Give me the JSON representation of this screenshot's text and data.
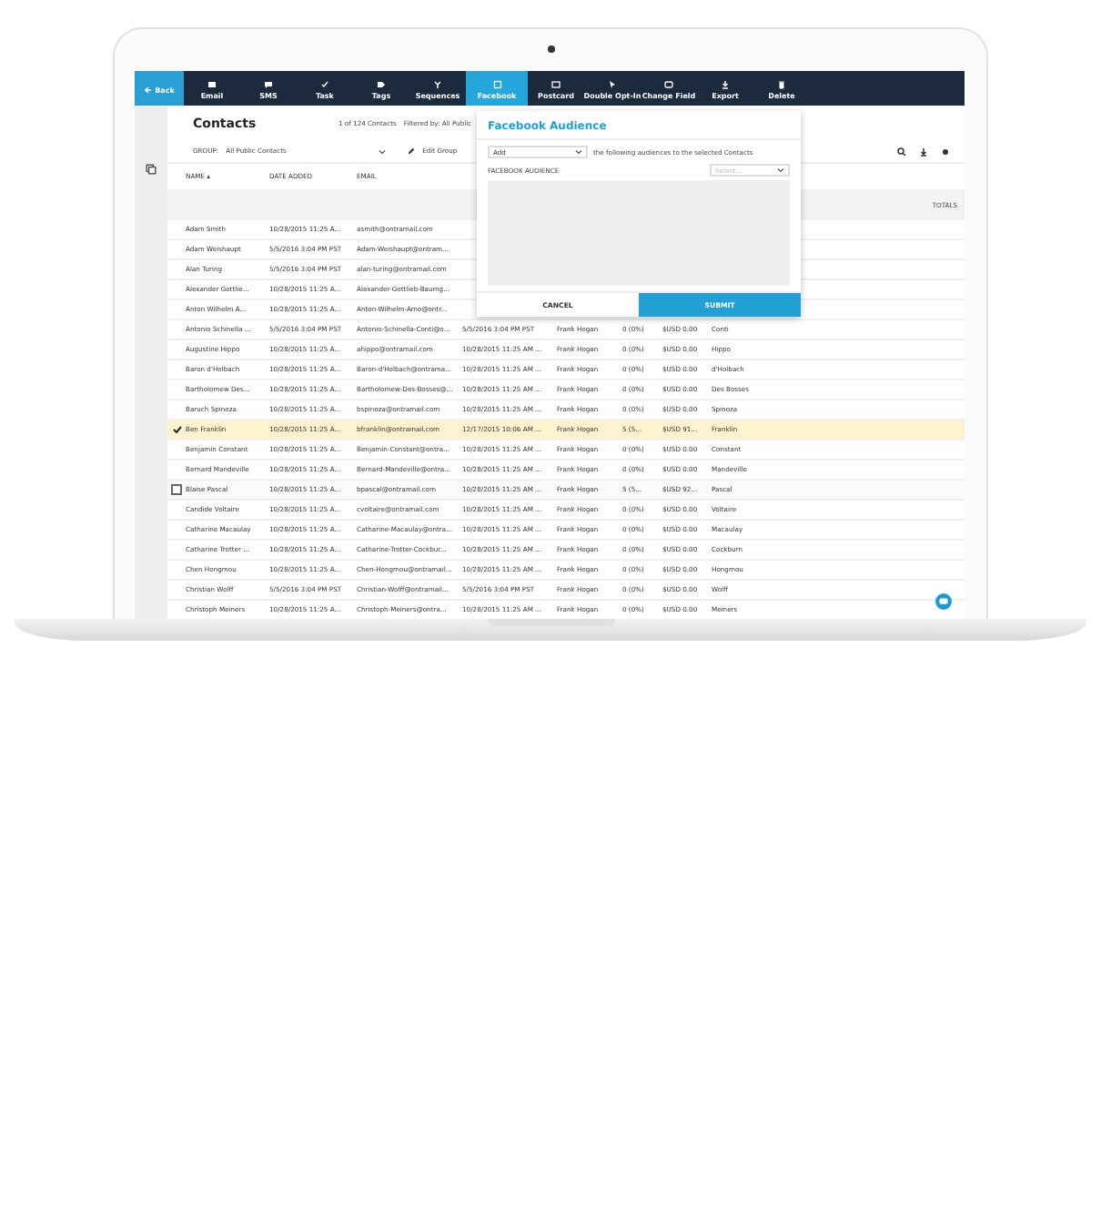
{
  "back": "Back",
  "toolbar": [
    {
      "label": "Email",
      "kind": "email",
      "selected": false
    },
    {
      "label": "SMS",
      "kind": "sms",
      "selected": false
    },
    {
      "label": "Task",
      "kind": "task",
      "selected": false
    },
    {
      "label": "Tags",
      "kind": "tags",
      "selected": false
    },
    {
      "label": "Sequences",
      "kind": "sequences",
      "selected": false
    },
    {
      "label": "Facebook",
      "kind": "facebook",
      "selected": true
    },
    {
      "label": "Postcard",
      "kind": "postcard",
      "selected": false
    },
    {
      "label": "Double Opt-In",
      "kind": "optin",
      "selected": false
    },
    {
      "label": "Change Field",
      "kind": "field",
      "selected": false
    },
    {
      "label": "Export",
      "kind": "export",
      "selected": false
    },
    {
      "label": "Delete",
      "kind": "delete",
      "selected": false
    }
  ],
  "page": {
    "title": "Contacts",
    "count": "1 of 124 Contacts",
    "filter": "Filtered by: All Public",
    "group_label": "GROUP:",
    "group_value": "All Public Contacts",
    "edit_group": "Edit Group"
  },
  "table": {
    "columns": [
      "NAME ▴",
      "DATE ADDED",
      "EMAIL"
    ],
    "totals": "TOTALS",
    "rows": [
      {
        "selected": false,
        "hovered": false,
        "cells": [
          "Adam Smith",
          "10/28/2015 11:25 A...",
          "asmith@ontramail.com"
        ]
      },
      {
        "selected": false,
        "hovered": false,
        "cells": [
          "Adam Weishaupt",
          "5/5/2016 3:04 PM PST",
          "Adam-Weishaupt@ontram..."
        ]
      },
      {
        "selected": false,
        "hovered": false,
        "cells": [
          "Alan Turing",
          "5/5/2016 3:04 PM PST",
          "alan-turing@ontramail.com"
        ]
      },
      {
        "selected": false,
        "hovered": false,
        "cells": [
          "Alexander Gottlie...",
          "10/28/2015 11:25 A...",
          "Alexander-Gottlieb-Baumg..."
        ]
      },
      {
        "selected": false,
        "hovered": false,
        "cells": [
          "Anton Wilhelm A...",
          "10/28/2015 11:25 A...",
          "Anton-Wilhelm-Amo@ontr..."
        ]
      },
      {
        "selected": false,
        "hovered": false,
        "cells": [
          "Antonio Schinella ...",
          "5/5/2016 3:04 PM PST",
          "Antonio-Schinella-Conti@o...",
          "5/5/2016 3:04 PM PST",
          "Frank Hogan",
          "0 (0%)",
          "$USD 0.00",
          "Conti"
        ]
      },
      {
        "selected": false,
        "hovered": false,
        "cells": [
          "Augustine Hippo",
          "10/28/2015 11:25 A...",
          "ahippo@ontramail.com",
          "10/28/2015 11:25 AM ...",
          "Frank Hogan",
          "0 (0%)",
          "$USD 0.00",
          "Hippo"
        ]
      },
      {
        "selected": false,
        "hovered": false,
        "cells": [
          "Baron d'Holbach",
          "10/28/2015 11:25 A...",
          "Baron-d'Holbach@ontrama...",
          "10/28/2015 11:25 AM ...",
          "Frank Hogan",
          "0 (0%)",
          "$USD 0.00",
          "d'Holbach"
        ]
      },
      {
        "selected": false,
        "hovered": false,
        "cells": [
          "Bartholomew Des...",
          "10/28/2015 11:25 A...",
          "Bartholomew-Des-Bosses@...",
          "10/28/2015 11:25 AM ...",
          "Frank Hogan",
          "0 (0%)",
          "$USD 0.00",
          "Des Bosses"
        ]
      },
      {
        "selected": false,
        "hovered": false,
        "cells": [
          "Baruch Spinoza",
          "10/28/2015 11:25 A...",
          "bspinoza@ontramail.com",
          "10/28/2015 11:25 AM ...",
          "Frank Hogan",
          "0 (0%)",
          "$USD 0.00",
          "Spinoza"
        ]
      },
      {
        "selected": true,
        "hovered": false,
        "cells": [
          "Ben Franklin",
          "10/28/2015 11:25 A...",
          "bfranklin@ontramail.com",
          "12/17/2015 10:06 AM ...",
          "Frank Hogan",
          "5 (5...",
          "$USD 91...",
          "Franklin"
        ]
      },
      {
        "selected": false,
        "hovered": false,
        "cells": [
          "Benjamin Constant",
          "10/28/2015 11:25 A...",
          "Benjamin-Constant@ontra...",
          "10/28/2015 11:25 AM ...",
          "Frank Hogan",
          "0 (0%)",
          "$USD 0.00",
          "Constant"
        ]
      },
      {
        "selected": false,
        "hovered": false,
        "cells": [
          "Bernard Mandeville",
          "10/28/2015 11:25 A...",
          "Bernard-Mandeville@ontra...",
          "10/28/2015 11:25 AM ...",
          "Frank Hogan",
          "0 (0%)",
          "$USD 0.00",
          "Mandeville"
        ]
      },
      {
        "selected": false,
        "hovered": true,
        "cells": [
          "Blaise Pascal",
          "10/28/2015 11:25 A...",
          "bpascal@ontramail.com",
          "10/28/2015 11:25 AM ...",
          "Frank Hogan",
          "5 (5...",
          "$USD 92...",
          "Pascal"
        ]
      },
      {
        "selected": false,
        "hovered": false,
        "cells": [
          "Candide Voltaire",
          "10/28/2015 11:25 A...",
          "cvoltaire@ontramail.com",
          "10/28/2015 11:25 AM ...",
          "Frank Hogan",
          "0 (0%)",
          "$USD 0.00",
          "Voltaire"
        ]
      },
      {
        "selected": false,
        "hovered": false,
        "cells": [
          "Catharine Macaulay",
          "10/28/2015 11:25 A...",
          "Catharine-Macaulay@ontra...",
          "10/28/2015 11:25 AM ...",
          "Frank Hogan",
          "0 (0%)",
          "$USD 0.00",
          "Macaulay"
        ]
      },
      {
        "selected": false,
        "hovered": false,
        "cells": [
          "Catharine Trotter ...",
          "10/28/2015 11:25 A...",
          "Catharine-Trotter-Cockbur...",
          "10/28/2015 11:25 AM ...",
          "Frank Hogan",
          "0 (0%)",
          "$USD 0.00",
          "Cockburn"
        ]
      },
      {
        "selected": false,
        "hovered": false,
        "cells": [
          "Chen Hongmou",
          "10/28/2015 11:25 A...",
          "Chen-Hongmou@ontramail...",
          "10/28/2015 11:25 AM ...",
          "Frank Hogan",
          "0 (0%)",
          "$USD 0.00",
          "Hongmou"
        ]
      },
      {
        "selected": false,
        "hovered": false,
        "cells": [
          "Christian Wolff",
          "5/5/2016 3:04 PM PST",
          "Christian-Wolff@ontramail...",
          "5/5/2016 3:04 PM PST",
          "Frank Hogan",
          "0 (0%)",
          "$USD 0.00",
          "Wolff"
        ]
      },
      {
        "selected": false,
        "hovered": false,
        "cells": [
          "Christoph Meiners",
          "10/28/2015 11:25 A...",
          "Christoph-Meiners@ontra...",
          "10/28/2015 11:25 AM ...",
          "Frank Hogan",
          "0 (0%)",
          "$USD 0.00",
          "Meiners"
        ]
      }
    ]
  },
  "dialog": {
    "title": "Facebook Audience",
    "action": "Add",
    "sentence": "the following audiences to the selected Contacts",
    "field_label": "FACEBOOK AUDIENCE",
    "placeholder": "Select...",
    "buttons": [
      "CANCEL",
      "SUBMIT"
    ]
  }
}
